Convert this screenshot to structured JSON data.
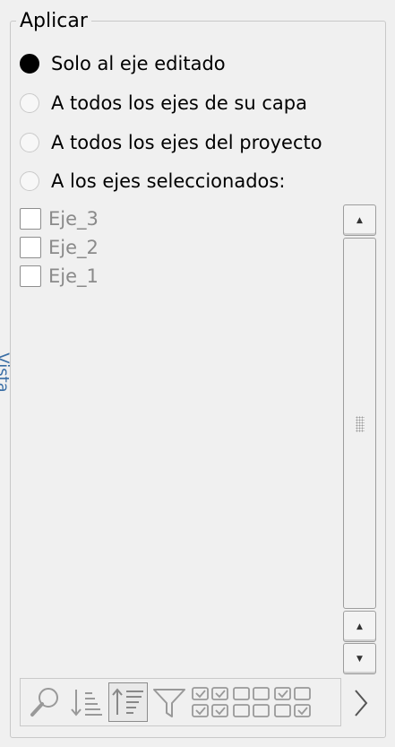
{
  "group": {
    "title": "Aplicar"
  },
  "apply_options": [
    {
      "label": "Solo al eje editado",
      "checked": true
    },
    {
      "label": "A todos los ejes de su capa",
      "checked": false
    },
    {
      "label": "A todos los ejes del proyecto",
      "checked": false
    },
    {
      "label": "A los ejes seleccionados:",
      "checked": false
    }
  ],
  "axes_list": [
    {
      "label": "Eje_3",
      "checked": false
    },
    {
      "label": "Eje_2",
      "checked": false
    },
    {
      "label": "Eje_1",
      "checked": false
    }
  ],
  "side_tab": {
    "label": "Vista"
  },
  "toolbar": {
    "icons": [
      "search-icon",
      "sort-ascending-icon",
      "sort-descending-icon",
      "filter-icon",
      "check-all-icon",
      "uncheck-all-icon",
      "invert-check-icon"
    ],
    "next_icon": "chevron-right-icon"
  },
  "colors": {
    "accent": "#3a6ea5",
    "radio_checked": "#000000",
    "disabled_text": "#8a8a8a"
  }
}
